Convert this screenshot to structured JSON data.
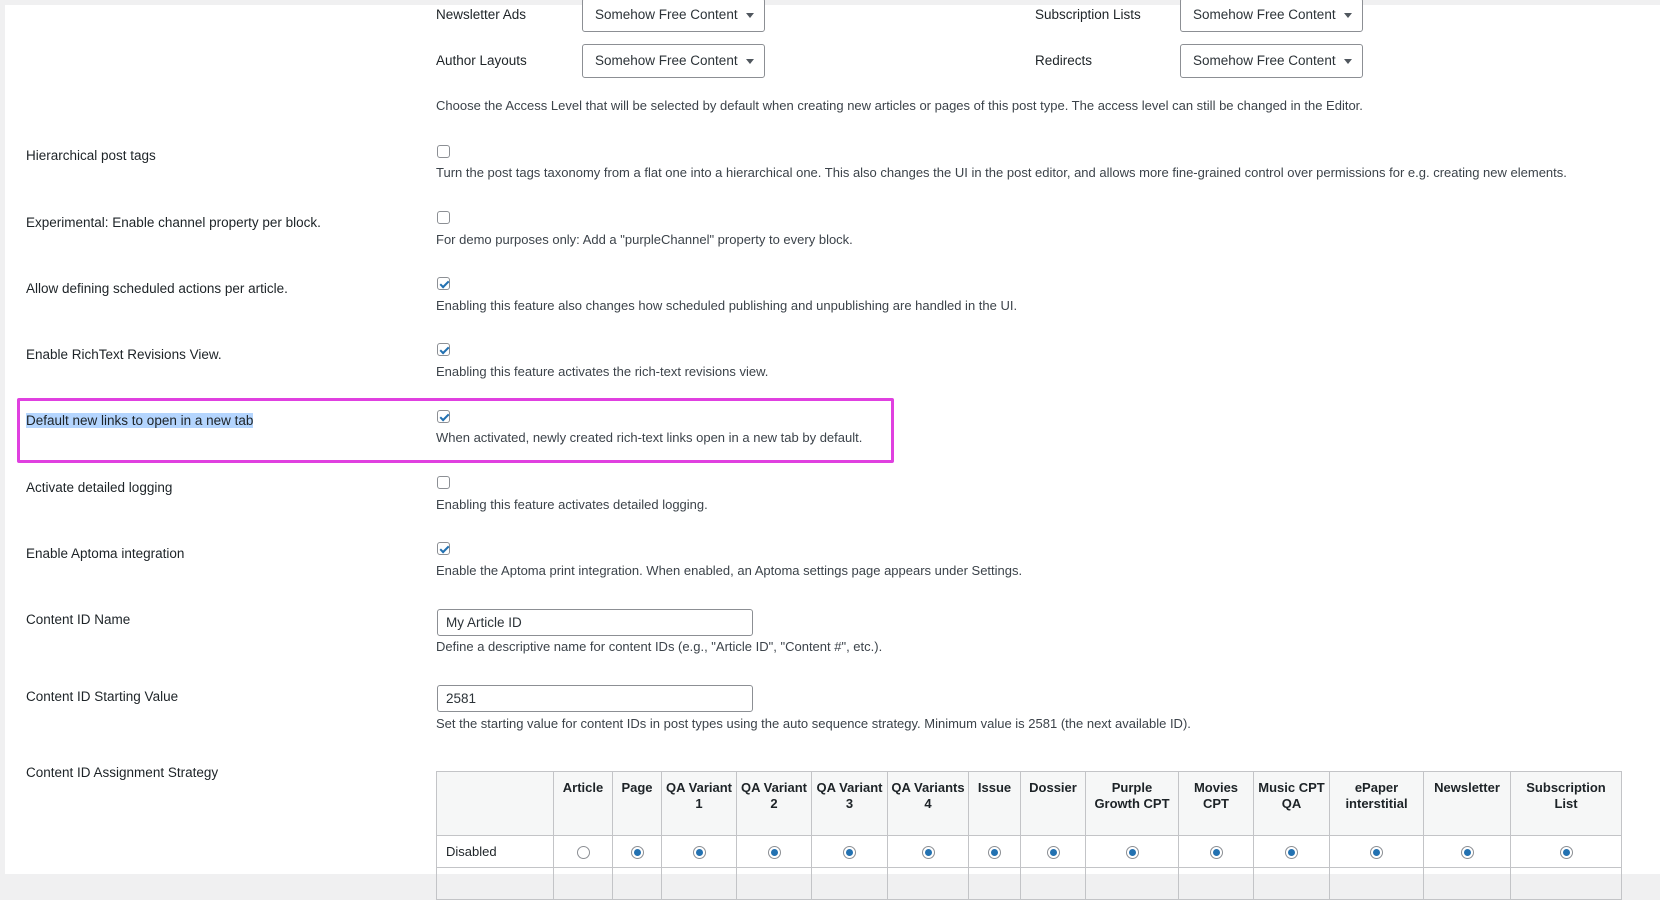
{
  "access_levels": {
    "newsletter_ads": {
      "label": "Newsletter Ads",
      "value": "Somehow Free Content"
    },
    "subscription_lists": {
      "label": "Subscription Lists",
      "value": "Somehow Free Content"
    },
    "author_layouts": {
      "label": "Author Layouts",
      "value": "Somehow Free Content"
    },
    "redirects": {
      "label": "Redirects",
      "value": "Somehow Free Content"
    },
    "description": "Choose the Access Level that will be selected by default when creating new articles or pages of this post type. The access level can still be changed in the Editor."
  },
  "settings": [
    {
      "label": "Hierarchical post tags",
      "checked": false,
      "description": "Turn the post tags taxonomy from a flat one into a hierarchical one. This also changes the UI in the post editor, and allows more fine-grained control over permissions for e.g. creating new elements."
    },
    {
      "label": "Experimental: Enable channel property per block.",
      "checked": false,
      "description": "For demo purposes only: Add a \"purpleChannel\" property to every block."
    },
    {
      "label": "Allow defining scheduled actions per article.",
      "checked": true,
      "description": "Enabling this feature also changes how scheduled publishing and unpublishing are handled in the UI."
    },
    {
      "label": "Enable RichText Revisions View.",
      "checked": true,
      "description": "Enabling this feature activates the rich-text revisions view."
    },
    {
      "label": "Default new links to open in a new tab",
      "checked": true,
      "description": "When activated, newly created rich-text links open in a new tab by default."
    },
    {
      "label": "Activate detailed logging",
      "checked": false,
      "description": "Enabling this feature activates detailed logging."
    },
    {
      "label": "Enable Aptoma integration",
      "checked": true,
      "description": "Enable the Aptoma print integration. When enabled, an Aptoma settings page appears under Settings."
    }
  ],
  "content_id_name": {
    "label": "Content ID Name",
    "value": "My Article ID",
    "description": "Define a descriptive name for content IDs (e.g., \"Article ID\", \"Content #\", etc.)."
  },
  "content_id_start": {
    "label": "Content ID Starting Value",
    "value": "2581",
    "description": "Set the starting value for content IDs in post types using the auto sequence strategy. Minimum value is 2581 (the next available ID)."
  },
  "strategy": {
    "label": "Content ID Assignment Strategy",
    "columns": [
      "Article",
      "Page",
      "QA Variant 1",
      "QA Variant 2",
      "QA Variant 3",
      "QA Variants 4",
      "Issue",
      "Dossier",
      "Purple Growth CPT",
      "Movies CPT",
      "Music CPT QA",
      "ePaper interstitial",
      "Newsletter",
      "Subscription List"
    ],
    "rows": [
      {
        "label": "Disabled",
        "selected": [
          false,
          true,
          true,
          true,
          true,
          true,
          true,
          true,
          true,
          true,
          true,
          true,
          true,
          true
        ]
      }
    ]
  },
  "colors": {
    "accent": "#2271b1",
    "highlight": "#e040e0",
    "selection": "#b4d5fe"
  }
}
